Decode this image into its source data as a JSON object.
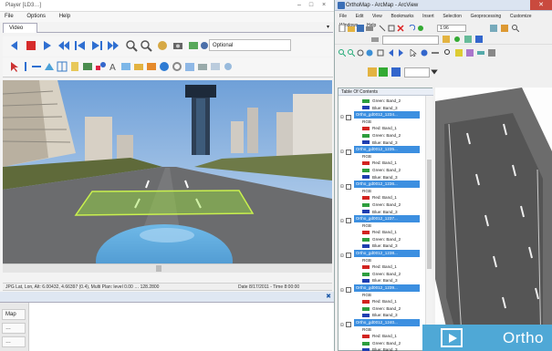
{
  "left_window": {
    "title": "Player [LD3…]",
    "menu": [
      "File",
      "Options",
      "Help"
    ],
    "tab": "Video",
    "speed_select": "Optional",
    "status_segments": [
      "JPG Lat, Lon, Alt: 6.00432, 4.66397 (0.4), Multi Plan: level 0.00 … 128.2800",
      "Date 8/17/2011 - Time 8:00:00"
    ],
    "bottom_buttons": [
      "Map",
      "…",
      "…"
    ]
  },
  "right_window": {
    "title": "OrthoMap - ArcMap - ArcView",
    "menu": [
      "File",
      "Edit",
      "View",
      "Bookmarks",
      "Insert",
      "Selection",
      "Geoprocessing",
      "Customize",
      "Windows",
      "Help"
    ],
    "toolbar": {
      "scale": "1:96"
    },
    "toc_header": "Table Of Contents",
    "layers": [
      {
        "type": "band",
        "color": "#2e9e3e",
        "label": "Green: Band_2"
      },
      {
        "type": "band",
        "color": "#1f3fb0",
        "label": "Blue: Band_3"
      },
      {
        "type": "layer",
        "label": "Ortho_gd0012_1234..."
      },
      {
        "type": "text",
        "label": "RGB"
      },
      {
        "type": "band",
        "color": "#d2231f",
        "label": "Red: Band_1"
      },
      {
        "type": "band",
        "color": "#2e9e3e",
        "label": "Green: Band_2"
      },
      {
        "type": "band",
        "color": "#1f3fb0",
        "label": "Blue: Band_3"
      },
      {
        "type": "layer",
        "label": "Ortho_gd0012_1235..."
      },
      {
        "type": "text",
        "label": "RGB"
      },
      {
        "type": "band",
        "color": "#d2231f",
        "label": "Red: Band_1"
      },
      {
        "type": "band",
        "color": "#2e9e3e",
        "label": "Green: Band_2"
      },
      {
        "type": "band",
        "color": "#1f3fb0",
        "label": "Blue: Band_3"
      },
      {
        "type": "layer",
        "label": "Ortho_gd0012_1236..."
      },
      {
        "type": "text",
        "label": "RGB"
      },
      {
        "type": "band",
        "color": "#d2231f",
        "label": "Red: Band_1"
      },
      {
        "type": "band",
        "color": "#2e9e3e",
        "label": "Green: Band_2"
      },
      {
        "type": "band",
        "color": "#1f3fb0",
        "label": "Blue: Band_3"
      },
      {
        "type": "layer",
        "label": "Ortho_gd0012_1237..."
      },
      {
        "type": "text",
        "label": "RGB"
      },
      {
        "type": "band",
        "color": "#d2231f",
        "label": "Red: Band_1"
      },
      {
        "type": "band",
        "color": "#2e9e3e",
        "label": "Green: Band_2"
      },
      {
        "type": "band",
        "color": "#1f3fb0",
        "label": "Blue: Band_3"
      },
      {
        "type": "layer",
        "label": "Ortho_gd0012_1238..."
      },
      {
        "type": "text",
        "label": "RGB"
      },
      {
        "type": "band",
        "color": "#d2231f",
        "label": "Red: Band_1"
      },
      {
        "type": "band",
        "color": "#2e9e3e",
        "label": "Green: Band_2"
      },
      {
        "type": "band",
        "color": "#1f3fb0",
        "label": "Blue: Band_3"
      },
      {
        "type": "layer",
        "label": "Ortho_gd0012_1239..."
      },
      {
        "type": "text",
        "label": "RGB"
      },
      {
        "type": "band",
        "color": "#d2231f",
        "label": "Red: Band_1"
      },
      {
        "type": "band",
        "color": "#2e9e3e",
        "label": "Green: Band_2"
      },
      {
        "type": "band",
        "color": "#1f3fb0",
        "label": "Blue: Band_3"
      },
      {
        "type": "layer",
        "label": "Ortho_gd0012_1240..."
      },
      {
        "type": "text",
        "label": "RGB"
      },
      {
        "type": "band",
        "color": "#d2231f",
        "label": "Red: Band_1"
      },
      {
        "type": "band",
        "color": "#2e9e3e",
        "label": "Green: Band_2"
      },
      {
        "type": "band",
        "color": "#1f3fb0",
        "label": "Blue: Band_3"
      }
    ]
  },
  "badge": {
    "text": "Ortho",
    "icon": "play-icon"
  },
  "colors": {
    "accent": "#4fa8d6",
    "selection": "#3c8fe0",
    "overlay": "#9adf3c"
  }
}
